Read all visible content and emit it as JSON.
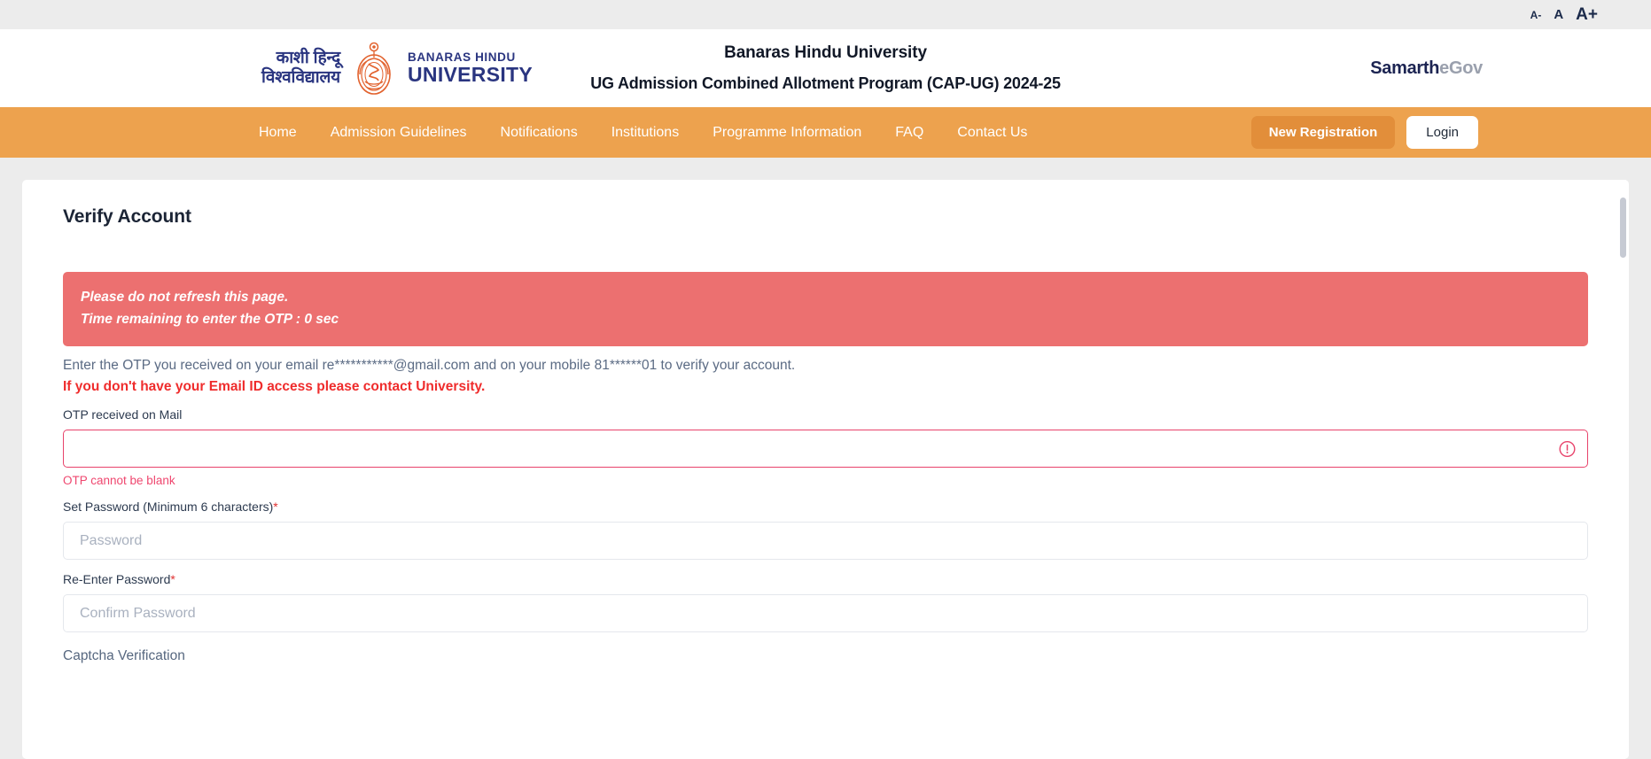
{
  "topbar": {
    "font_decrease": "A-",
    "font_normal": "A",
    "font_increase": "A+"
  },
  "masthead": {
    "logo_hindi_line1": "काशी हिन्दू",
    "logo_hindi_line2": "विश्वविद्यालय",
    "logo_en_line1": "BANARAS HINDU",
    "logo_en_line2": "UNIVERSITY",
    "title": "Banaras Hindu University",
    "subtitle": "UG Admission Combined Allotment Program (CAP-UG) 2024-25",
    "samarth_bold": "Samarth",
    "samarth_light": "eGov"
  },
  "nav": {
    "items": [
      {
        "label": "Home"
      },
      {
        "label": "Admission Guidelines"
      },
      {
        "label": "Notifications"
      },
      {
        "label": "Institutions"
      },
      {
        "label": "Programme Information"
      },
      {
        "label": "FAQ"
      },
      {
        "label": "Contact Us"
      }
    ],
    "new_registration": "New Registration",
    "login": "Login",
    "bg_color": "#eda24e",
    "new_registration_color": "#e28e3a"
  },
  "main": {
    "page_title": "Verify Account",
    "alert": {
      "line1": "Please do not refresh this page.",
      "line2": "Time remaining to enter the OTP : 0 sec",
      "bg_color": "#ec7070"
    },
    "instruction": "Enter the OTP you received on your email re***********@gmail.com and on your mobile 81******01 to verify your account.",
    "instruction_warning": "If you don't have your Email ID access please contact University.",
    "otp": {
      "label": "OTP received on Mail",
      "value": "",
      "placeholder": "",
      "error": "OTP cannot be blank",
      "error_color": "#ef476f",
      "border_color": "#e8436b"
    },
    "password": {
      "label": "Set Password (Minimum 6 characters)",
      "required_mark": "*",
      "value": "",
      "placeholder": "Password"
    },
    "confirm_password": {
      "label": "Re-Enter Password",
      "required_mark": "*",
      "value": "",
      "placeholder": "Confirm Password"
    },
    "captcha_label": "Captcha Verification"
  }
}
